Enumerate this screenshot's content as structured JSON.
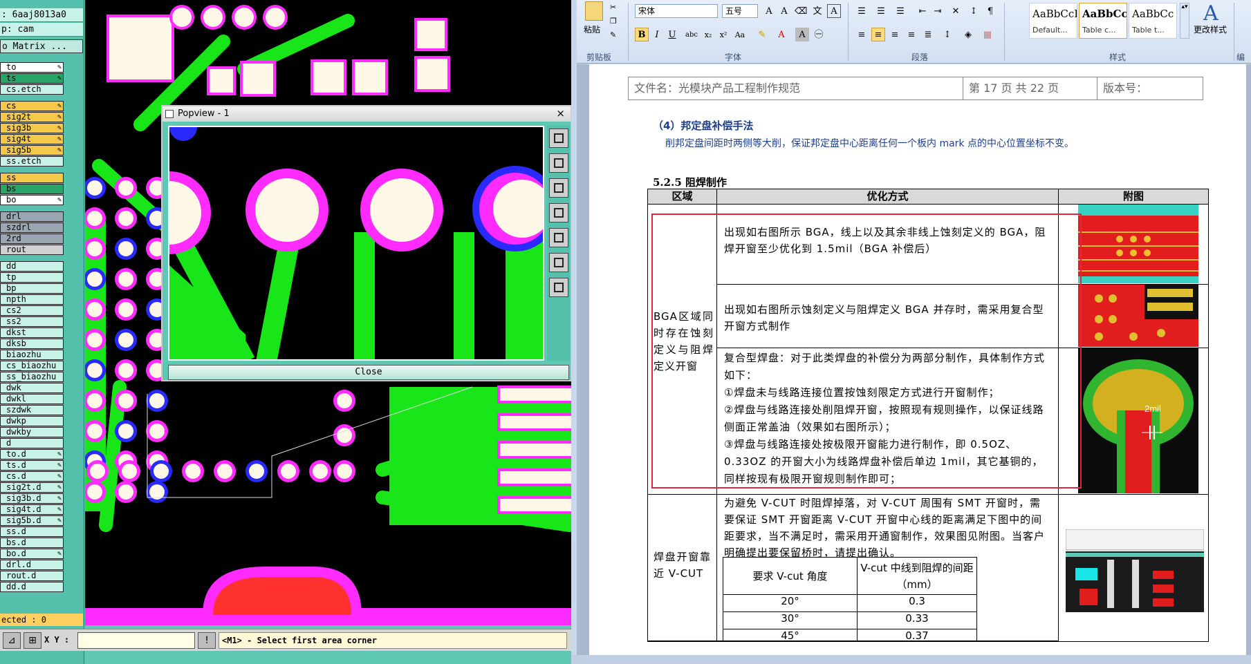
{
  "cam": {
    "header_lines": [
      ": 6aaj8013a0",
      "p: cam",
      "o Matrix ..."
    ],
    "layers": [
      {
        "name": "to",
        "color": "#ffffff",
        "pen": true
      },
      {
        "name": "ts",
        "color": "#2aa56a",
        "pen": true
      },
      {
        "name": "cs.etch",
        "color": "#c7f2e8",
        "pen": false
      },
      {
        "name": "cs",
        "color": "#f5c84a",
        "pen": true
      },
      {
        "name": "sig2t",
        "color": "#f5c84a",
        "pen": true
      },
      {
        "name": "sig3b",
        "color": "#f5c84a",
        "pen": true
      },
      {
        "name": "sig4t",
        "color": "#f5c84a",
        "pen": true
      },
      {
        "name": "sig5b",
        "color": "#f5c84a",
        "pen": true
      },
      {
        "name": "ss.etch",
        "color": "#c7f2e8",
        "pen": false
      },
      {
        "name": "ss",
        "color": "#f5c84a",
        "pen": false
      },
      {
        "name": "bs",
        "color": "#2aa56a",
        "pen": false
      },
      {
        "name": "bo",
        "color": "#ffffff",
        "pen": true
      },
      {
        "name": "drl",
        "color": "#9aa7b3",
        "pen": false
      },
      {
        "name": "szdrl",
        "color": "#9aa7b3",
        "pen": false
      },
      {
        "name": "2rd",
        "color": "#9aa7b3",
        "pen": false
      },
      {
        "name": "rout",
        "color": "#d0d0d0",
        "pen": false
      },
      {
        "name": "dd",
        "color": "#c7f2e8",
        "pen": false
      },
      {
        "name": "tp",
        "color": "#c7f2e8",
        "pen": false
      },
      {
        "name": "bp",
        "color": "#c7f2e8",
        "pen": false
      },
      {
        "name": "npth",
        "color": "#c7f2e8",
        "pen": false
      },
      {
        "name": "cs2",
        "color": "#c7f2e8",
        "pen": false
      },
      {
        "name": "ss2",
        "color": "#c7f2e8",
        "pen": false
      },
      {
        "name": "dkst",
        "color": "#c7f2e8",
        "pen": false
      },
      {
        "name": "dksb",
        "color": "#c7f2e8",
        "pen": false
      },
      {
        "name": "biaozhu",
        "color": "#c7f2e8",
        "pen": false
      },
      {
        "name": "cs_biaozhu",
        "color": "#c7f2e8",
        "pen": false
      },
      {
        "name": "ss_biaozhu",
        "color": "#c7f2e8",
        "pen": false
      },
      {
        "name": "dwk",
        "color": "#c7f2e8",
        "pen": false
      },
      {
        "name": "dwkl",
        "color": "#c7f2e8",
        "pen": false
      },
      {
        "name": "szdwk",
        "color": "#c7f2e8",
        "pen": false
      },
      {
        "name": "dwkp",
        "color": "#c7f2e8",
        "pen": false
      },
      {
        "name": "dwkby",
        "color": "#c7f2e8",
        "pen": false
      },
      {
        "name": "d",
        "color": "#c7f2e8",
        "pen": false
      },
      {
        "name": "to.d",
        "color": "#c7f2e8",
        "pen": true
      },
      {
        "name": "ts.d",
        "color": "#c7f2e8",
        "pen": true
      },
      {
        "name": "cs.d",
        "color": "#c7f2e8",
        "pen": true
      },
      {
        "name": "sig2t.d",
        "color": "#c7f2e8",
        "pen": true
      },
      {
        "name": "sig3b.d",
        "color": "#c7f2e8",
        "pen": true
      },
      {
        "name": "sig4t.d",
        "color": "#c7f2e8",
        "pen": true
      },
      {
        "name": "sig5b.d",
        "color": "#c7f2e8",
        "pen": true
      },
      {
        "name": "ss.d",
        "color": "#c7f2e8",
        "pen": false
      },
      {
        "name": "bs.d",
        "color": "#c7f2e8",
        "pen": false
      },
      {
        "name": "bo.d",
        "color": "#c7f2e8",
        "pen": true
      },
      {
        "name": "drl.d",
        "color": "#c7f2e8",
        "pen": false
      },
      {
        "name": "rout.d",
        "color": "#c7f2e8",
        "pen": false
      },
      {
        "name": "dd.d",
        "color": "#c7f2e8",
        "pen": false
      }
    ],
    "selected_text": "ected : 0",
    "xy_label": "X Y :",
    "xy_value": "",
    "message": "<M1> - Select first area corner",
    "popview": {
      "title": "Popview - 1",
      "close_label": "Close",
      "close_x": "×"
    },
    "colors": {
      "pad": "#fff8e6",
      "copper": "#19e619",
      "mask": "#ff2bff",
      "ring": "#2a2aff",
      "trace": "#19e619"
    }
  },
  "word": {
    "ribbon": {
      "paste_label": "粘贴",
      "clipboard_label": "剪贴板",
      "font_name": "宋体",
      "font_size": "五号",
      "font_group_label": "字体",
      "para_group_label": "段落",
      "styles_group_label": "样式",
      "edit_group_label": "编辑",
      "change_styles_label": "更改样式",
      "styles": [
        {
          "preview": "AaBbCcI",
          "name": "Default..."
        },
        {
          "preview": "AaBbCc",
          "name": "Table c..."
        },
        {
          "preview": "AaBbCc",
          "name": "Table t..."
        }
      ]
    },
    "doc": {
      "header": {
        "file": "文件名：光模块产品工程制作规范",
        "page": "第 17 页  共 22 页",
        "version": "版本号："
      },
      "sec_title": "（4）邦定盘补偿手法",
      "sec_para": "削邦定盘间距时两侧等大削，保证邦定盘中心距离任何一个板内 mark 点的中心位置坐标不变。",
      "sec_525": "5.2.5 阻焊制作",
      "table": {
        "headers": [
          "区域",
          "优化方式",
          "附图"
        ],
        "area1": "BGA区域同时存在蚀刻定义与阻焊定义开窗",
        "row1": "出现如右图所示 BGA，线上以及其余非线上蚀刻定义的 BGA，阻焊开窗至少优化到 1.5mil（BGA 补偿后）",
        "row2": "出现如右图所示蚀刻定义与阻焊定义 BGA 并存时，需采用复合型开窗方式制作",
        "row3_lines": [
          "复合型焊盘：对于此类焊盘的补偿分为两部分制作，具体制作方式如下：",
          "①焊盘未与线路连接位置按蚀刻限定方式进行开窗制作；",
          "②焊盘与线路连接处削阻焊开窗，按照现有规则操作，以保证线路侧面正常盖油（效果如右图所示）；",
          "③焊盘与线路连接处按极限开窗能力进行制作，即 0.5OZ、0.33OZ 的开窗大小为线路焊盘补偿后单边 1mil，其它基铜的，同样按现有极限开窗规则制作即可；"
        ],
        "area2": "焊盘开窗靠近 V-CUT",
        "row4": "为避免 V-CUT 时阻焊掉落，对 V-CUT 周围有 SMT 开窗时，需要保证 SMT 开窗距离 V-CUT 开窗中心线的距离满足下图中的间距要求，当不满足时，需采用开通窗制作，效果图见附图。当客户明确提出要保留桥时，请提出确认。",
        "vcut_headers": [
          "要求 V-cut 角度",
          "V-cut 中线到阻焊的间距（mm）"
        ],
        "vcut_rows": [
          [
            "20°",
            "0.3"
          ],
          [
            "30°",
            "0.33"
          ],
          [
            "45°",
            "0.37"
          ]
        ],
        "img_label_2mil": "2mil"
      }
    }
  }
}
